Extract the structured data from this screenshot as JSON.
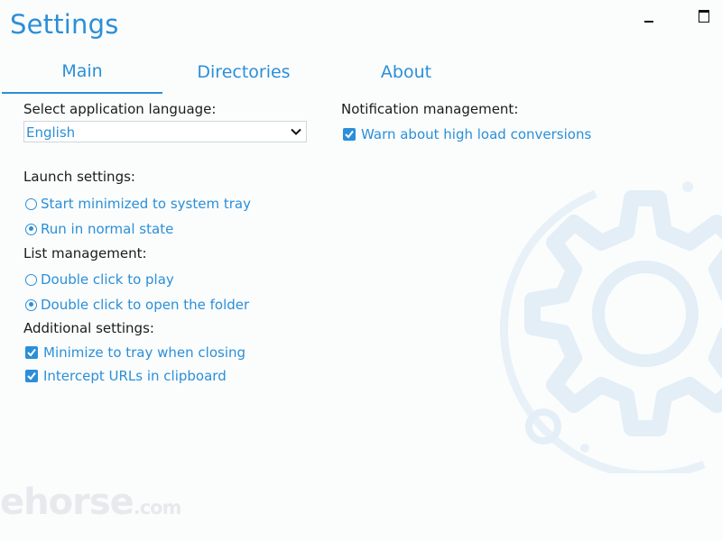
{
  "window": {
    "title": "Settings"
  },
  "tabs": [
    {
      "label": "Main",
      "active": true
    },
    {
      "label": "Directories",
      "active": false
    },
    {
      "label": "About",
      "active": false
    }
  ],
  "language": {
    "label": "Select application language:",
    "selected": "English"
  },
  "notification": {
    "label": "Notification management:",
    "warn_high_load": {
      "label": "Warn about high load conversions",
      "checked": true
    }
  },
  "launch": {
    "label": "Launch settings:",
    "options": [
      {
        "label": "Start minimized to system tray",
        "selected": false
      },
      {
        "label": "Run in normal state",
        "selected": true
      }
    ]
  },
  "list_management": {
    "label": "List management:",
    "options": [
      {
        "label": "Double click to play",
        "selected": false
      },
      {
        "label": "Double click to open the folder",
        "selected": true
      }
    ]
  },
  "additional": {
    "label": "Additional settings:",
    "options": [
      {
        "label": "Minimize to tray when closing",
        "checked": true
      },
      {
        "label": "Intercept URLs in clipboard",
        "checked": true
      }
    ]
  },
  "watermark": {
    "text": "ehorse",
    "suffix": ".com"
  },
  "colors": {
    "accent": "#2b8fd8",
    "text": "#1b1b1b",
    "background": "#fbfdfd"
  }
}
